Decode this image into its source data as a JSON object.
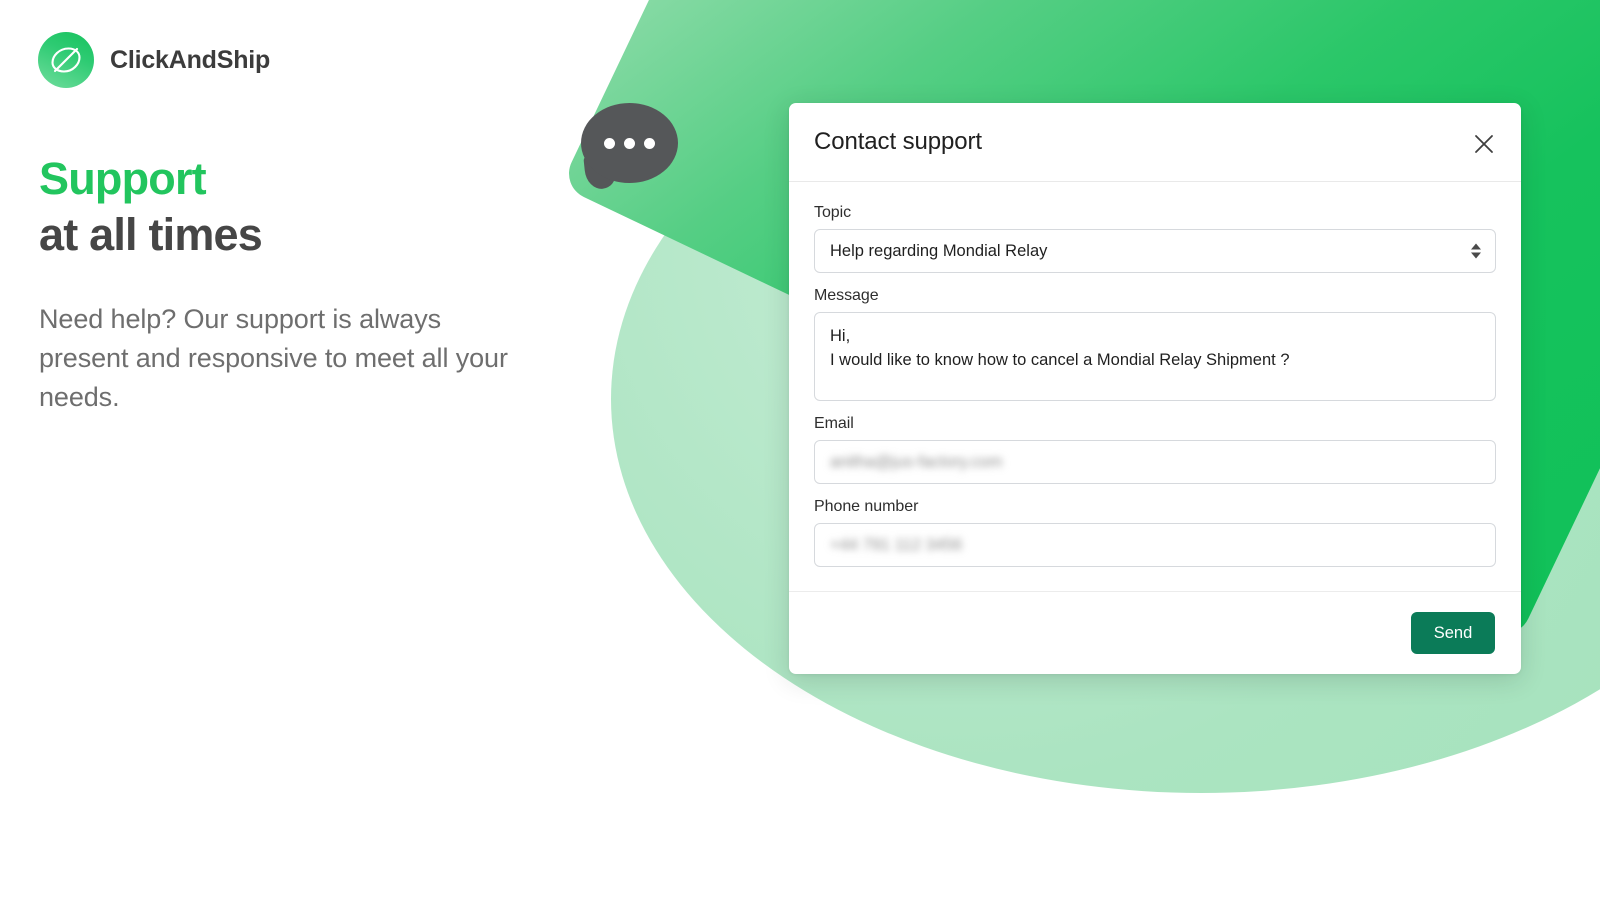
{
  "brand": {
    "name": "ClickAndShip",
    "logo_icon": "clickandship-loop-logo-icon",
    "logo_gradient_from": "#17c25d",
    "logo_gradient_to": "#71dd9d"
  },
  "hero": {
    "headline_line1": "Support",
    "headline_line2": "at all times",
    "headline_accent_color": "#22c55e",
    "headline_dark_color": "#464646",
    "subtext": "Need help? Our support is always present and responsive to meet all your needs."
  },
  "decor": {
    "chat_bubble_icon": "chat-bubble-ellipsis-icon",
    "chat_bubble_color": "#555759",
    "backdrop_circle_color": "#abe4c1",
    "backdrop_panel_color": "#16c25d"
  },
  "modal": {
    "title": "Contact support",
    "close_icon": "close-x-icon",
    "fields": {
      "topic": {
        "label": "Topic",
        "value": "Help regarding Mondial Relay",
        "stepper_icon": "select-updown-caret-icon"
      },
      "message": {
        "label": "Message",
        "value": "Hi,\nI would like to know how to cancel a Mondial Relay Shipment ?"
      },
      "email": {
        "label": "Email",
        "value": "anitha@jus-factory.com",
        "redacted": true
      },
      "phone": {
        "label": "Phone number",
        "value": "+44 791 112 3456",
        "redacted": true
      }
    },
    "footer": {
      "send_label": "Send",
      "send_color": "#0b7b58"
    }
  }
}
